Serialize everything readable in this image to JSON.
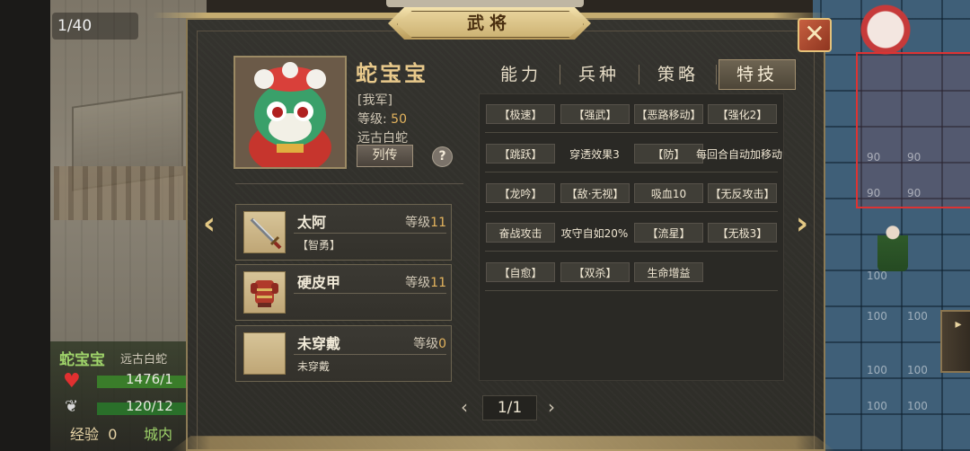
{
  "background": {
    "turn_counter": "1/40",
    "unit": {
      "name": "蛇宝宝",
      "type": "远古白蛇",
      "hp": "1476/1",
      "mp": "120/12",
      "exp_label": "经验",
      "exp_value": "0",
      "location": "城内"
    },
    "map_numbers": [
      "90",
      "90",
      "90",
      "90",
      "100",
      "100",
      "100",
      "100",
      "100",
      "100",
      "100"
    ]
  },
  "dialog": {
    "title": "武将",
    "close_icon": "close-x-icon"
  },
  "hero": {
    "name": "蛇宝宝",
    "faction": "[我军]",
    "level_label": "等级:",
    "level_value": "50",
    "unit_type": "远古白蛇",
    "bio_button": "列传",
    "help_button": "?"
  },
  "equipment": [
    {
      "name": "太阿",
      "level_label": "等级",
      "level": "11",
      "attr": "【智勇】",
      "icon": "sword-icon"
    },
    {
      "name": "硬皮甲",
      "level_label": "等级",
      "level": "11",
      "attr": "",
      "icon": "armor-icon"
    },
    {
      "name": "未穿戴",
      "level_label": "等级",
      "level": "0",
      "attr": "未穿戴",
      "icon": "empty-slot-icon"
    }
  ],
  "tabs": [
    {
      "label": "能力",
      "active": false
    },
    {
      "label": "兵种",
      "active": false
    },
    {
      "label": "策略",
      "active": false
    },
    {
      "label": "特技",
      "active": true
    }
  ],
  "skills": [
    [
      "【极速】",
      "【强武】",
      "【恶路移动】",
      "【强化2】"
    ],
    [
      "【跳跃】",
      "穿透效果3",
      "【防】",
      "每回合自动加移动"
    ],
    [
      "【龙吟】",
      "【敌·无视】",
      "吸血10",
      "【无反攻击】"
    ],
    [
      "奋战攻击",
      "攻守自如20%",
      "【流星】",
      "【无极3】"
    ],
    [
      "【自愈】",
      "【双杀】",
      "生命增益"
    ]
  ],
  "pager": {
    "prev": "‹",
    "current": "1/1",
    "next": "›"
  },
  "colors": {
    "gold": "#e3c884",
    "panel": "#2e2d28",
    "accent_value": "#e4b45e"
  }
}
